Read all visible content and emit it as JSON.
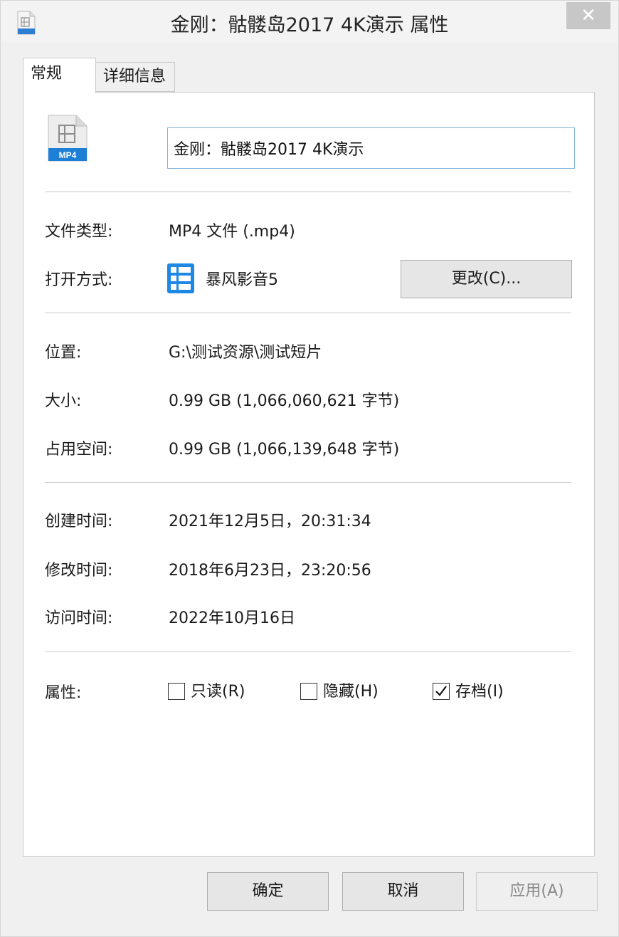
{
  "window": {
    "title": "金刚：骷髅岛2017 4K演示 属性",
    "close_glyph": "✕"
  },
  "tabs": [
    {
      "label": "常规"
    },
    {
      "label": "详细信息"
    }
  ],
  "file": {
    "name": "金刚：骷髅岛2017 4K演示",
    "icon_label": "MP4",
    "icon": "mp4-file-icon"
  },
  "info": {
    "file_type": {
      "label": "文件类型:",
      "value": "MP4 文件 (.mp4)"
    },
    "open_with": {
      "label": "打开方式:",
      "app": "暴风影音5",
      "app_icon": "storm-player-icon",
      "change_button": "更改(C)..."
    },
    "location": {
      "label": "位置:",
      "value": "G:\\测试资源\\测试短片"
    },
    "size": {
      "label": "大小:",
      "value": "0.99 GB (1,066,060,621 字节)"
    },
    "size_on_disk": {
      "label": "占用空间:",
      "value": "0.99 GB (1,066,139,648 字节)"
    },
    "created": {
      "label": "创建时间:",
      "value": "2021年12月5日，20:31:34"
    },
    "modified": {
      "label": "修改时间:",
      "value": "2018年6月23日，23:20:56"
    },
    "accessed": {
      "label": "访问时间:",
      "value": "2022年10月16日"
    }
  },
  "attributes": {
    "label": "属性:",
    "readonly": {
      "label": "只读(R)",
      "checked": false
    },
    "hidden": {
      "label": "隐藏(H)",
      "checked": false
    },
    "archive": {
      "label": "存档(I)",
      "checked": true
    }
  },
  "buttons": {
    "ok": "确定",
    "cancel": "取消",
    "apply": "应用(A)"
  },
  "colors": {
    "icon_blue": "#1e88e5",
    "input_border": "#7fb0d8",
    "apply_disabled_text": "#8a8a8a"
  }
}
